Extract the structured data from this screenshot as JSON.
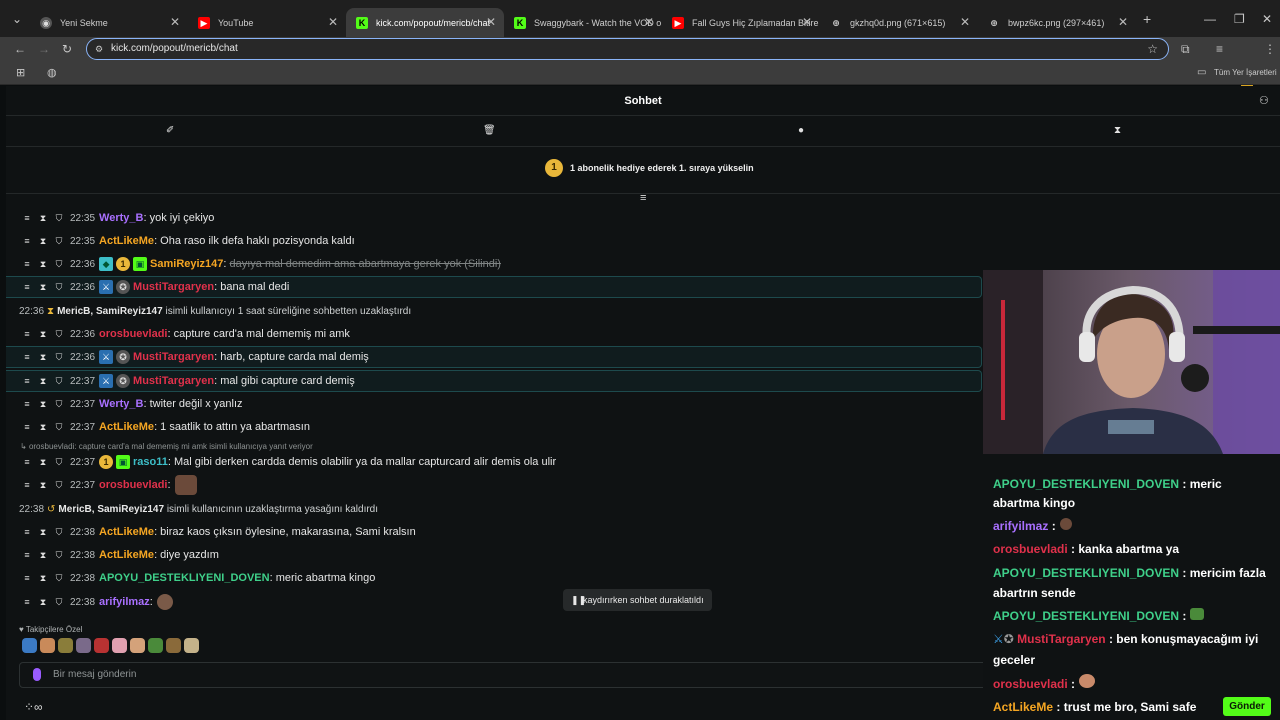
{
  "browser": {
    "tabs": [
      {
        "label": "Yeni Sekme",
        "icon": "chrome-icon"
      },
      {
        "label": "YouTube",
        "icon": "youtube-icon"
      },
      {
        "label": "kick.com/popout/mericb/chat",
        "icon": "kick-icon"
      },
      {
        "label": "Swaggybark - Watch the VOD o",
        "icon": "kick-icon"
      },
      {
        "label": "Fall Guys Hiç Zıplamadan Bitire",
        "icon": "youtube-icon"
      },
      {
        "label": "gkzhq0d.png (671×615)",
        "icon": "globe-icon"
      },
      {
        "label": "bwpz6kc.png (297×461)",
        "icon": "globe-icon"
      }
    ],
    "url": "kick.com/popout/mericb/chat",
    "bookmarks_label": "Tüm Yer İşaretleri"
  },
  "chat": {
    "title": "Sohbet",
    "gift_banner": {
      "coin": "1",
      "text": "1 abonelik hediye ederek 1. sıraya yükselin"
    },
    "messages": [
      {
        "time": "22:35",
        "user": "Werty_B",
        "text": ": yok iyi çekiyo"
      },
      {
        "time": "22:35",
        "user": "ActLikeMe",
        "text": ": Oha raso ilk defa haklı pozisyonda kaldı"
      },
      {
        "time": "22:36",
        "user": "SamiReyiz147",
        "sep": ":",
        "text": "dayıya mal demedim ama abartmaya gerek yok (Silindi)"
      },
      {
        "time": "22:36",
        "user": "MustiTargaryen",
        "text": ": bana mal dedi"
      },
      {
        "time": "22:36",
        "user": "MericB, SamiReyiz147",
        "text": "isimli kullanıcıyı 1 saat süreliğine sohbetten uzaklaştırdı"
      },
      {
        "time": "22:36",
        "user": "orosbuevladi",
        "text": ": capture card'a mal dememiş mi amk"
      },
      {
        "time": "22:36",
        "user": "MustiTargaryen",
        "text": ": harb, capture carda mal demiş"
      },
      {
        "time": "22:37",
        "user": "MustiTargaryen",
        "text": ": mal gibi capture card demiş"
      },
      {
        "time": "22:37",
        "user": "Werty_B",
        "text": ": twiter değil x yanlız"
      },
      {
        "time": "22:37",
        "user": "ActLikeMe",
        "text": ": 1 saatlik to attın ya abartmasın"
      },
      {
        "time": "22:37",
        "user": "raso11",
        "text": ": Mal gibi derken cardda demis olabilir ya da mallar capturcard alir demis ola ulir",
        "badge": "1"
      },
      {
        "time": "22:37",
        "user": "orosbuevladi",
        "text": ":"
      },
      {
        "time": "22:38",
        "user": "MericB, SamiReyiz147",
        "text": "isimli kullanıcının uzaklaştırma yasağını kaldırdı"
      },
      {
        "time": "22:38",
        "user": "ActLikeMe",
        "text": ": biraz kaos çıksın öylesine, makarasına, Sami kralsın"
      },
      {
        "time": "22:38",
        "user": "ActLikeMe",
        "text": ": diye yazdım"
      },
      {
        "time": "22:38",
        "user": "APOYU_DESTEKLIYENI_DOVEN",
        "text": ": meric abartma kingo"
      },
      {
        "time": "22:38",
        "user": "arifyilmaz",
        "text": ":"
      }
    ],
    "sami_badge": "1",
    "reply_ref": "orosbuevladi: capture card'a mal dememiş mi amk isimli kullanıcıya yanıt veriyor",
    "paused": "kaydırırken sohbet duraklatıldı",
    "follower_label": "Takipçilere Özel",
    "input_placeholder": "Bir mesaj gönderin"
  },
  "overlay": {
    "lines": [
      {
        "user": "APOYU_DESTEKLIYENI_DOVEN",
        "text": " : meric"
      },
      {
        "user": "",
        "text": "abartma kingo"
      },
      {
        "user": "arifyilmaz",
        "text": " :"
      },
      {
        "user": "orosbuevladi",
        "text": " : kanka abartma ya"
      },
      {
        "user": "APOYU_DESTEKLIYENI_DOVEN",
        "text": " : mericim fazla"
      },
      {
        "user": "",
        "text": "abartrın sende"
      },
      {
        "user": "APOYU_DESTEKLIYENI_DOVEN",
        "text": " :"
      },
      {
        "user": "MustiTargaryen",
        "text": " : ben konuşmayacağım iyi"
      },
      {
        "user": "",
        "text": "geceler"
      },
      {
        "user": "orosbuevladi",
        "text": " :"
      },
      {
        "user": "ActLikeMe",
        "text": " : trust me bro, Sami safe"
      }
    ],
    "send_label": "Gönder"
  },
  "colors": {
    "Werty_B": "#a970ff",
    "ActLikeMe": "#f5a623",
    "SamiReyiz147": "#f5a623",
    "MustiTargaryen": "#e0314b",
    "orosbuevladi": "#e0314b",
    "raso11": "#3dbec8",
    "APOYU_DESTEKLIYENI_DOVEN": "#3fd08a",
    "arifyilmaz": "#a970ff",
    "kick_green": "#53fc18"
  }
}
